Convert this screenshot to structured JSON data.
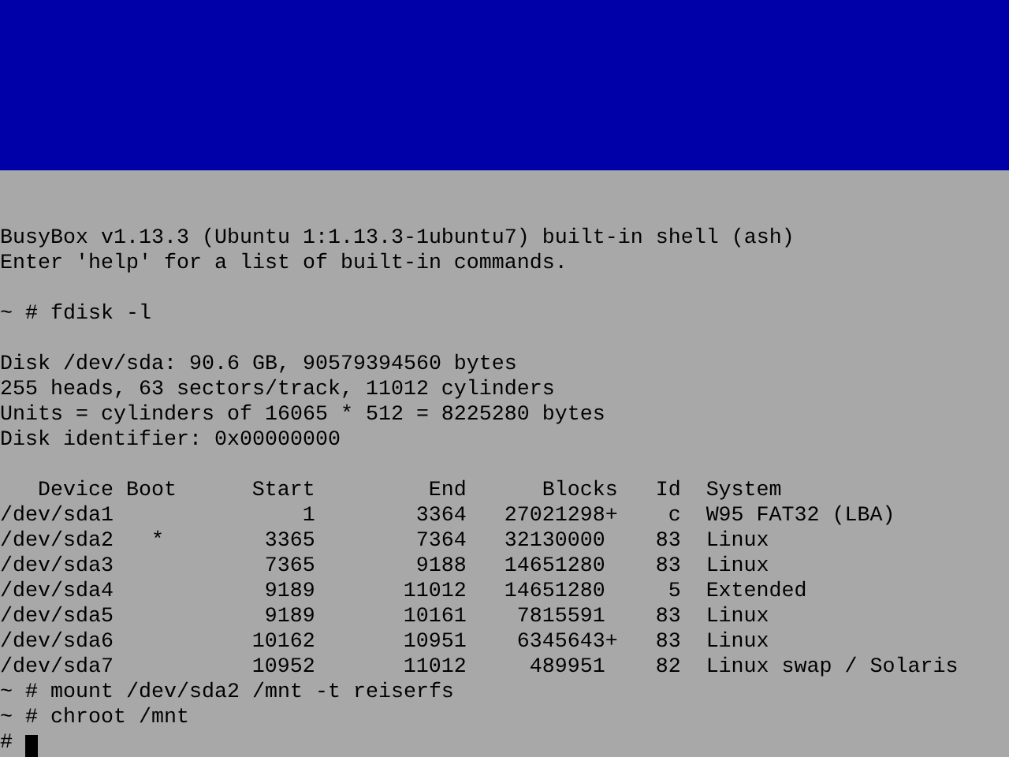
{
  "terminal": {
    "banner": [
      "BusyBox v1.13.3 (Ubuntu 1:1.13.3-1ubuntu7) built-in shell (ash)",
      "Enter 'help' for a list of built-in commands."
    ],
    "command": "~ # fdisk -l",
    "disk_info": [
      "Disk /dev/sda: 90.6 GB, 90579394560 bytes",
      "255 heads, 63 sectors/track, 11012 cylinders",
      "Units = cylinders of 16065 * 512 = 8225280 bytes",
      "Disk identifier: 0x00000000"
    ],
    "partition_table": {
      "columns": [
        "Device",
        "Boot",
        "Start",
        "End",
        "Blocks",
        "Id",
        "System"
      ],
      "rows": [
        {
          "device": "/dev/sda1",
          "start": "1",
          "end": "3364",
          "blocks": "27021298",
          "flag": "+",
          "id": "c",
          "system": "W95 FAT32 (LBA)"
        },
        {
          "device": "/dev/sda2",
          "boot": "*",
          "start": "3365",
          "end": "7364",
          "blocks": "32130000",
          "id": "83",
          "system": "Linux"
        },
        {
          "device": "/dev/sda3",
          "start": "7365",
          "end": "9188",
          "blocks": "14651280",
          "id": "83",
          "system": "Linux"
        },
        {
          "device": "/dev/sda4",
          "start": "9189",
          "end": "11012",
          "blocks": "14651280",
          "id": "5",
          "system": "Extended"
        },
        {
          "device": "/dev/sda5",
          "start": "9189",
          "end": "10161",
          "blocks": "7815591",
          "id": "83",
          "system": "Linux"
        },
        {
          "device": "/dev/sda6",
          "start": "10162",
          "end": "10951",
          "blocks": "6345643",
          "flag": "+",
          "id": "83",
          "system": "Linux"
        },
        {
          "device": "/dev/sda7",
          "start": "10952",
          "end": "11012",
          "blocks": "489951",
          "id": "82",
          "system": "Linux swap / Solaris"
        }
      ]
    },
    "later_commands": [
      "~ # mount /dev/sda2 /mnt -t reiserfs",
      "~ # chroot /mnt"
    ],
    "prompt": "#"
  }
}
